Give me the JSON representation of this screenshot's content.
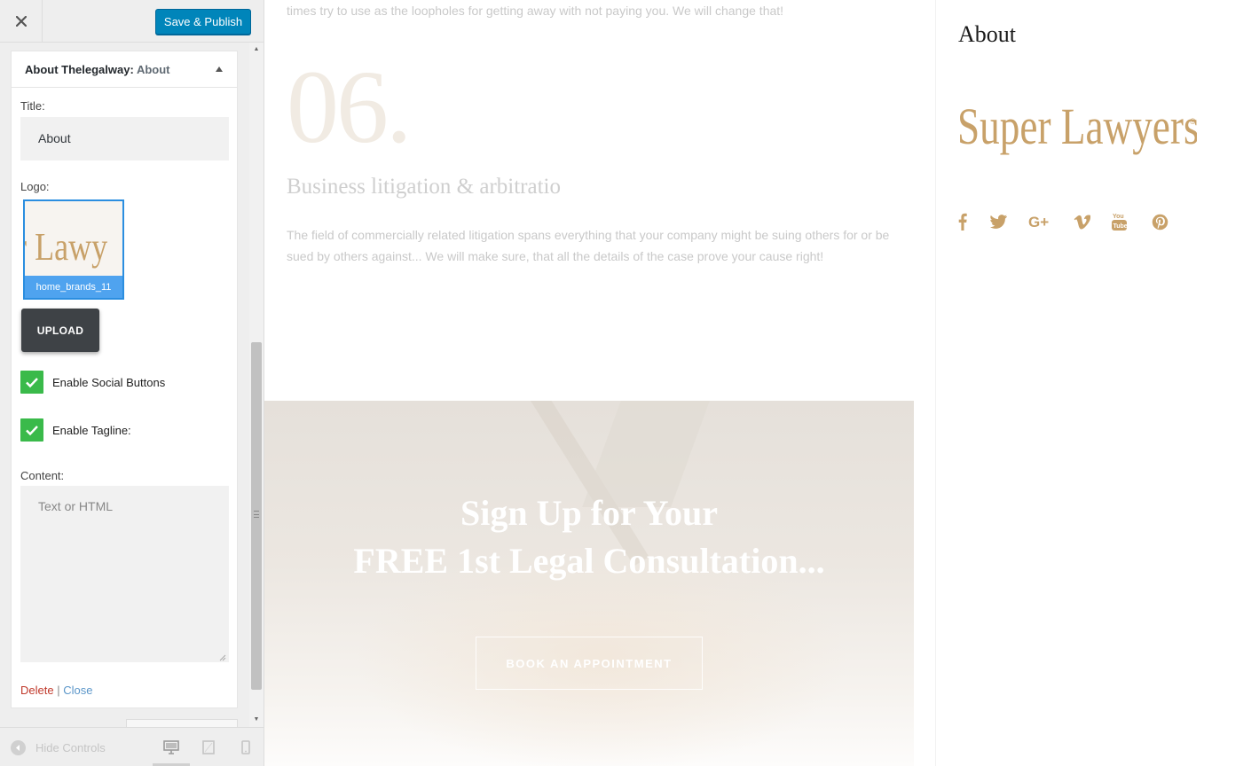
{
  "sidebar": {
    "save_label": "Save & Publish",
    "widget": {
      "title": "About Thelegalway:",
      "in_title": "About",
      "title_label": "Title:",
      "title_value": "About",
      "logo_label": "Logo:",
      "logo_image_text": "per Lawy",
      "logo_filename": "home_brands_11",
      "upload_label": "UPLOAD",
      "enable_social_label": "Enable Social Buttons",
      "enable_social_checked": true,
      "enable_tagline_label": "Enable Tagline:",
      "enable_tagline_checked": true,
      "content_label": "Content:",
      "content_placeholder": "Text or HTML",
      "delete_label": "Delete",
      "separator": "|",
      "close_label": "Close"
    },
    "footer": {
      "hide_controls_label": "Hide Controls",
      "devices": [
        "desktop",
        "tablet",
        "mobile"
      ]
    }
  },
  "preview": {
    "top_text": "times try to use as the loopholes for getting away with not paying you. We will change that!",
    "number": "06.",
    "section_title": "Business litigation & arbitratio",
    "section_body": "The field of commercially related litigation spans everything that your company might be suing others for or be sued by others against... We will make sure, that all the details of the case prove your cause right!",
    "banner_line1": "Sign Up for Your",
    "banner_line2": "FREE 1st Legal Consultation...",
    "banner_button": "BOOK AN APPOINTMENT",
    "sidebar_title": "About",
    "sidebar_logo_text": "Super Lawyers",
    "sidebar_logo_mark": "®",
    "social_icons": [
      "facebook-icon",
      "twitter-icon",
      "google-plus-icon",
      "vimeo-icon",
      "youtube-icon",
      "pinterest-icon"
    ],
    "accent_color": "#c8a169"
  },
  "colors": {
    "publish_button": "#0085ba",
    "checkbox": "#3aba4a",
    "upload_button": "#3e4246",
    "logo_selected_border": "#2b8ee0",
    "delete_link": "#c0392b",
    "close_link": "#5b96c9"
  }
}
